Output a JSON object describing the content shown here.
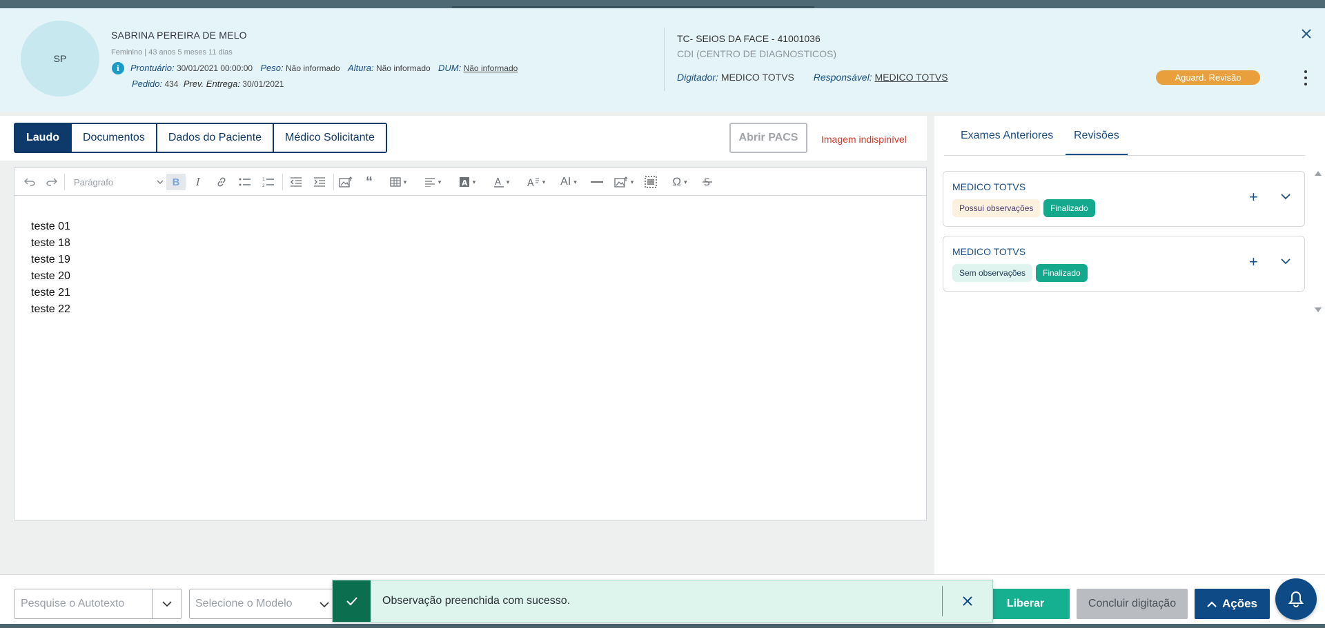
{
  "patient": {
    "initials": "SP",
    "name": "SABRINA PEREIRA DE MELO",
    "meta": "Feminino | 43 anos 5 meses 11 dias",
    "prontuario_label": "Prontuário:",
    "prontuario_value": "30/01/2021 00:00:00",
    "peso_label": "Peso:",
    "peso_value": "Não informado",
    "altura_label": "Altura:",
    "altura_value": "Não informado",
    "dum_label": "DUM:",
    "dum_value": "Não informado",
    "pedido_label": "Pedido:",
    "pedido_value": "434",
    "entrega_label": "Prev. Entrega:",
    "entrega_value": "30/01/2021"
  },
  "exam": {
    "title": "TC- SEIOS DA FACE - 41001036",
    "clinic": "CDI (CENTRO DE DIAGNOSTICOS)",
    "digitador_label": "Digitador:",
    "digitador_value": "MEDICO TOTVS",
    "responsavel_label": "Responsável:",
    "responsavel_value": "MEDICO TOTVS",
    "status": "Aguard. Revisão",
    "status_color": "#e9a03c"
  },
  "tabs": [
    {
      "label": "Laudo",
      "active": true
    },
    {
      "label": "Documentos",
      "active": false
    },
    {
      "label": "Dados do Paciente",
      "active": false
    },
    {
      "label": "Médico Solicitante",
      "active": false
    }
  ],
  "pacs": {
    "button_label": "Abrir PACS",
    "image_status": "Imagem indispinível"
  },
  "editor": {
    "paragraph_style": "Parágrafo",
    "lines": [
      "teste 01",
      "teste 18",
      "teste 19",
      "teste 20",
      "teste 21",
      "teste 22"
    ]
  },
  "right_tabs": [
    {
      "label": "Exames Anteriores",
      "active": false
    },
    {
      "label": "Revisões",
      "active": true
    }
  ],
  "revisions": [
    {
      "author": "MEDICO TOTVS",
      "obs": "Possui observações",
      "status": "Finalizado"
    },
    {
      "author": "MEDICO TOTVS",
      "obs": "Sem observações",
      "status": "Finalizado"
    }
  ],
  "bottom": {
    "autotexto_placeholder": "Pesquise o Autotexto",
    "modelo_placeholder": "Selecione o Modelo",
    "liberar_label": "Liberar",
    "concluir_label": "Concluir digitação",
    "acoes_label": "Ações"
  },
  "toast": {
    "message": "Observação preenchida com sucesso."
  },
  "colors": {
    "brand": "#0d3a6b",
    "success": "#14b08f",
    "info_icon": "#1a9bc8"
  }
}
